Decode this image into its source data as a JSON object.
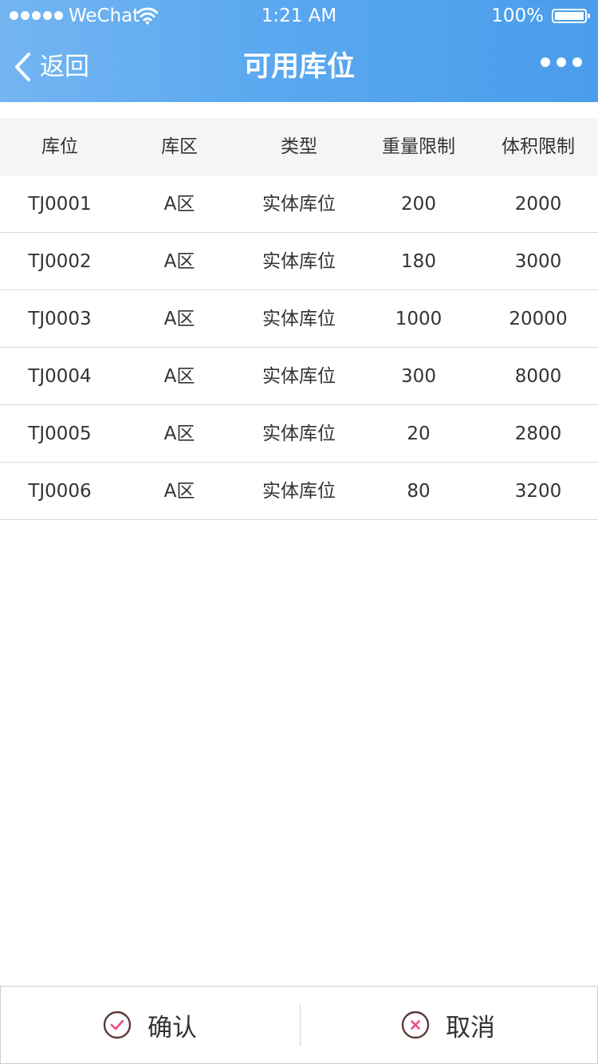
{
  "status_bar": {
    "carrier": "WeChat",
    "time": "1:21 AM",
    "battery": "100%"
  },
  "nav": {
    "back_label": "返回",
    "title": "可用库位"
  },
  "table": {
    "headers": [
      "库位",
      "库区",
      "类型",
      "重量限制",
      "体积限制"
    ],
    "rows": [
      [
        "TJ0001",
        "A区",
        "实体库位",
        "200",
        "2000"
      ],
      [
        "TJ0002",
        "A区",
        "实体库位",
        "180",
        "3000"
      ],
      [
        "TJ0003",
        "A区",
        "实体库位",
        "1000",
        "20000"
      ],
      [
        "TJ0004",
        "A区",
        "实体库位",
        "300",
        "8000"
      ],
      [
        "TJ0005",
        "A区",
        "实体库位",
        "20",
        "2800"
      ],
      [
        "TJ0006",
        "A区",
        "实体库位",
        "80",
        "3200"
      ]
    ]
  },
  "footer": {
    "confirm_label": "确认",
    "cancel_label": "取消"
  },
  "colors": {
    "header_gradient_start": "#74b5f2",
    "header_gradient_end": "#4a9deb",
    "icon_ring": "#5a3a36",
    "icon_accent": "#e84a86"
  },
  "icons": {
    "back": "chevron-left-icon",
    "more": "more-dots-icon",
    "confirm": "check-circle-icon",
    "cancel": "close-circle-icon"
  }
}
